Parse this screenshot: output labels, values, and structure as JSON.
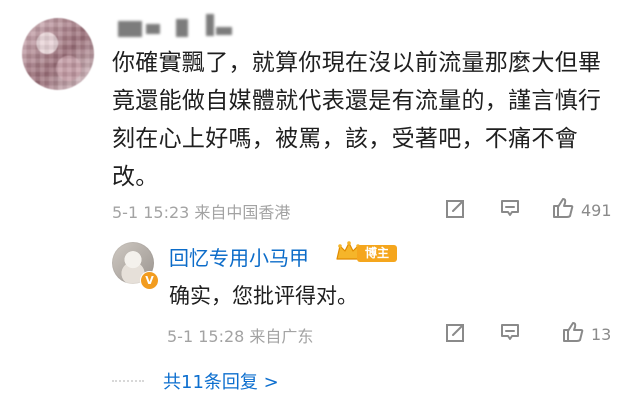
{
  "main_comment": {
    "text": "你確實飄了，就算你現在沒以前流量那麼大但畢竟還能做自媒體就代表還是有流量的，謹言慎行刻在心上好嗎，被罵，該，受著吧，不痛不會改。",
    "timestamp": "5-1 15:23",
    "location": "来自中国香港",
    "like_count": "491",
    "icons": [
      "share-icon",
      "comment-icon",
      "like-icon"
    ]
  },
  "reply": {
    "author": "回忆专用小马甲",
    "badge": "博主",
    "verified_badge": "V",
    "text": "确实，您批评得对。",
    "timestamp": "5-1 15:28",
    "location": "来自广东",
    "like_count": "13"
  },
  "thread": {
    "more_replies": "共11条回复 >"
  },
  "colors": {
    "link_blue": "#0c6cc9",
    "badge_orange": "#f5a61d",
    "meta_gray": "#a3a3a3"
  }
}
